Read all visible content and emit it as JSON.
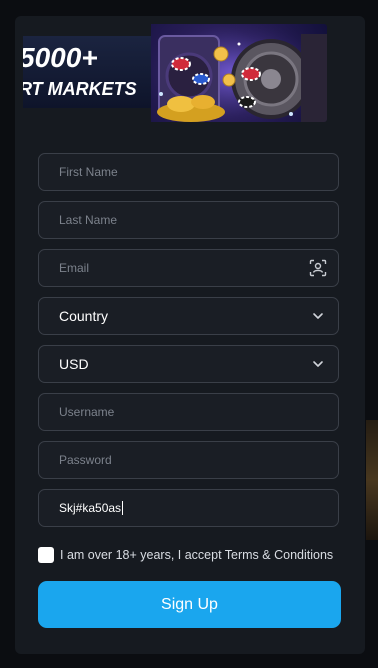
{
  "banner": {
    "headline_line1": "5000+",
    "headline_line2": "RT MARKETS"
  },
  "form": {
    "first_name": {
      "placeholder": "First Name"
    },
    "last_name": {
      "placeholder": "Last Name"
    },
    "email": {
      "placeholder": "Email",
      "icon": "contact-card-icon"
    },
    "country": {
      "selected": "Country",
      "icon": "chevron-down-icon"
    },
    "currency": {
      "selected": "USD",
      "icon": "chevron-down-icon"
    },
    "username": {
      "placeholder": "Username"
    },
    "password": {
      "placeholder": "Password"
    },
    "promo_code": {
      "value": "Skj#ka50as"
    },
    "terms_label": "I am over 18+ years, I accept Terms & Conditions",
    "terms_checked": false,
    "submit_label": "Sign Up"
  },
  "colors": {
    "background": "#0b0d11",
    "panel": "#161a20",
    "field_border": "#3a3f48",
    "placeholder": "#7c828c",
    "primary_button": "#1aa6ee"
  }
}
